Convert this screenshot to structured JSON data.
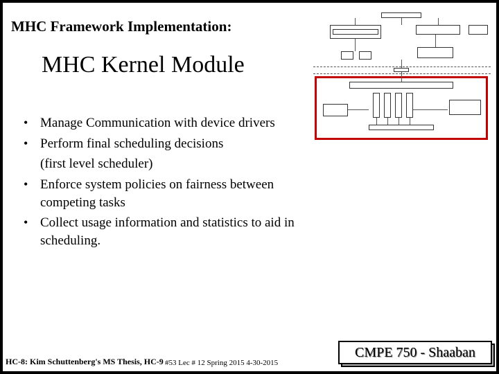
{
  "pre_title": "MHC Framework Implementation:",
  "main_title": "MHC Kernel Module",
  "bullets": [
    "Manage Communication with device drivers",
    "Perform final scheduling decisions",
    "Enforce system policies on fairness between competing tasks",
    "Collect usage information and statistics to aid in scheduling."
  ],
  "sub_line": "(first level scheduler)",
  "footer": {
    "left": "HC-8: Kim Schuttenberg's MS Thesis, HC-9",
    "center": "#53  Lec # 12   Spring 2015  4-30-2015"
  },
  "badge": "CMPE 750 - Shaaban"
}
